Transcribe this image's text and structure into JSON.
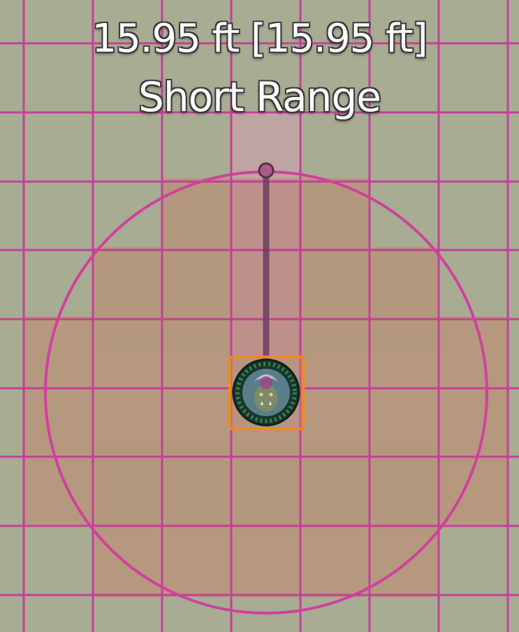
{
  "measurement": {
    "distance_text": "15.95 ft [15.95 ft]",
    "range_text": "Short Range"
  },
  "colors": {
    "background": "#a8ac92",
    "grid_line": "#c8359a",
    "range_ring": "#d0409f",
    "range_fill": "#b8866e",
    "ruler": "#6b3f60",
    "token_border": "#f08a1c"
  },
  "token": {
    "icon": "orc-warrior-portrait-icon",
    "selected": true
  }
}
